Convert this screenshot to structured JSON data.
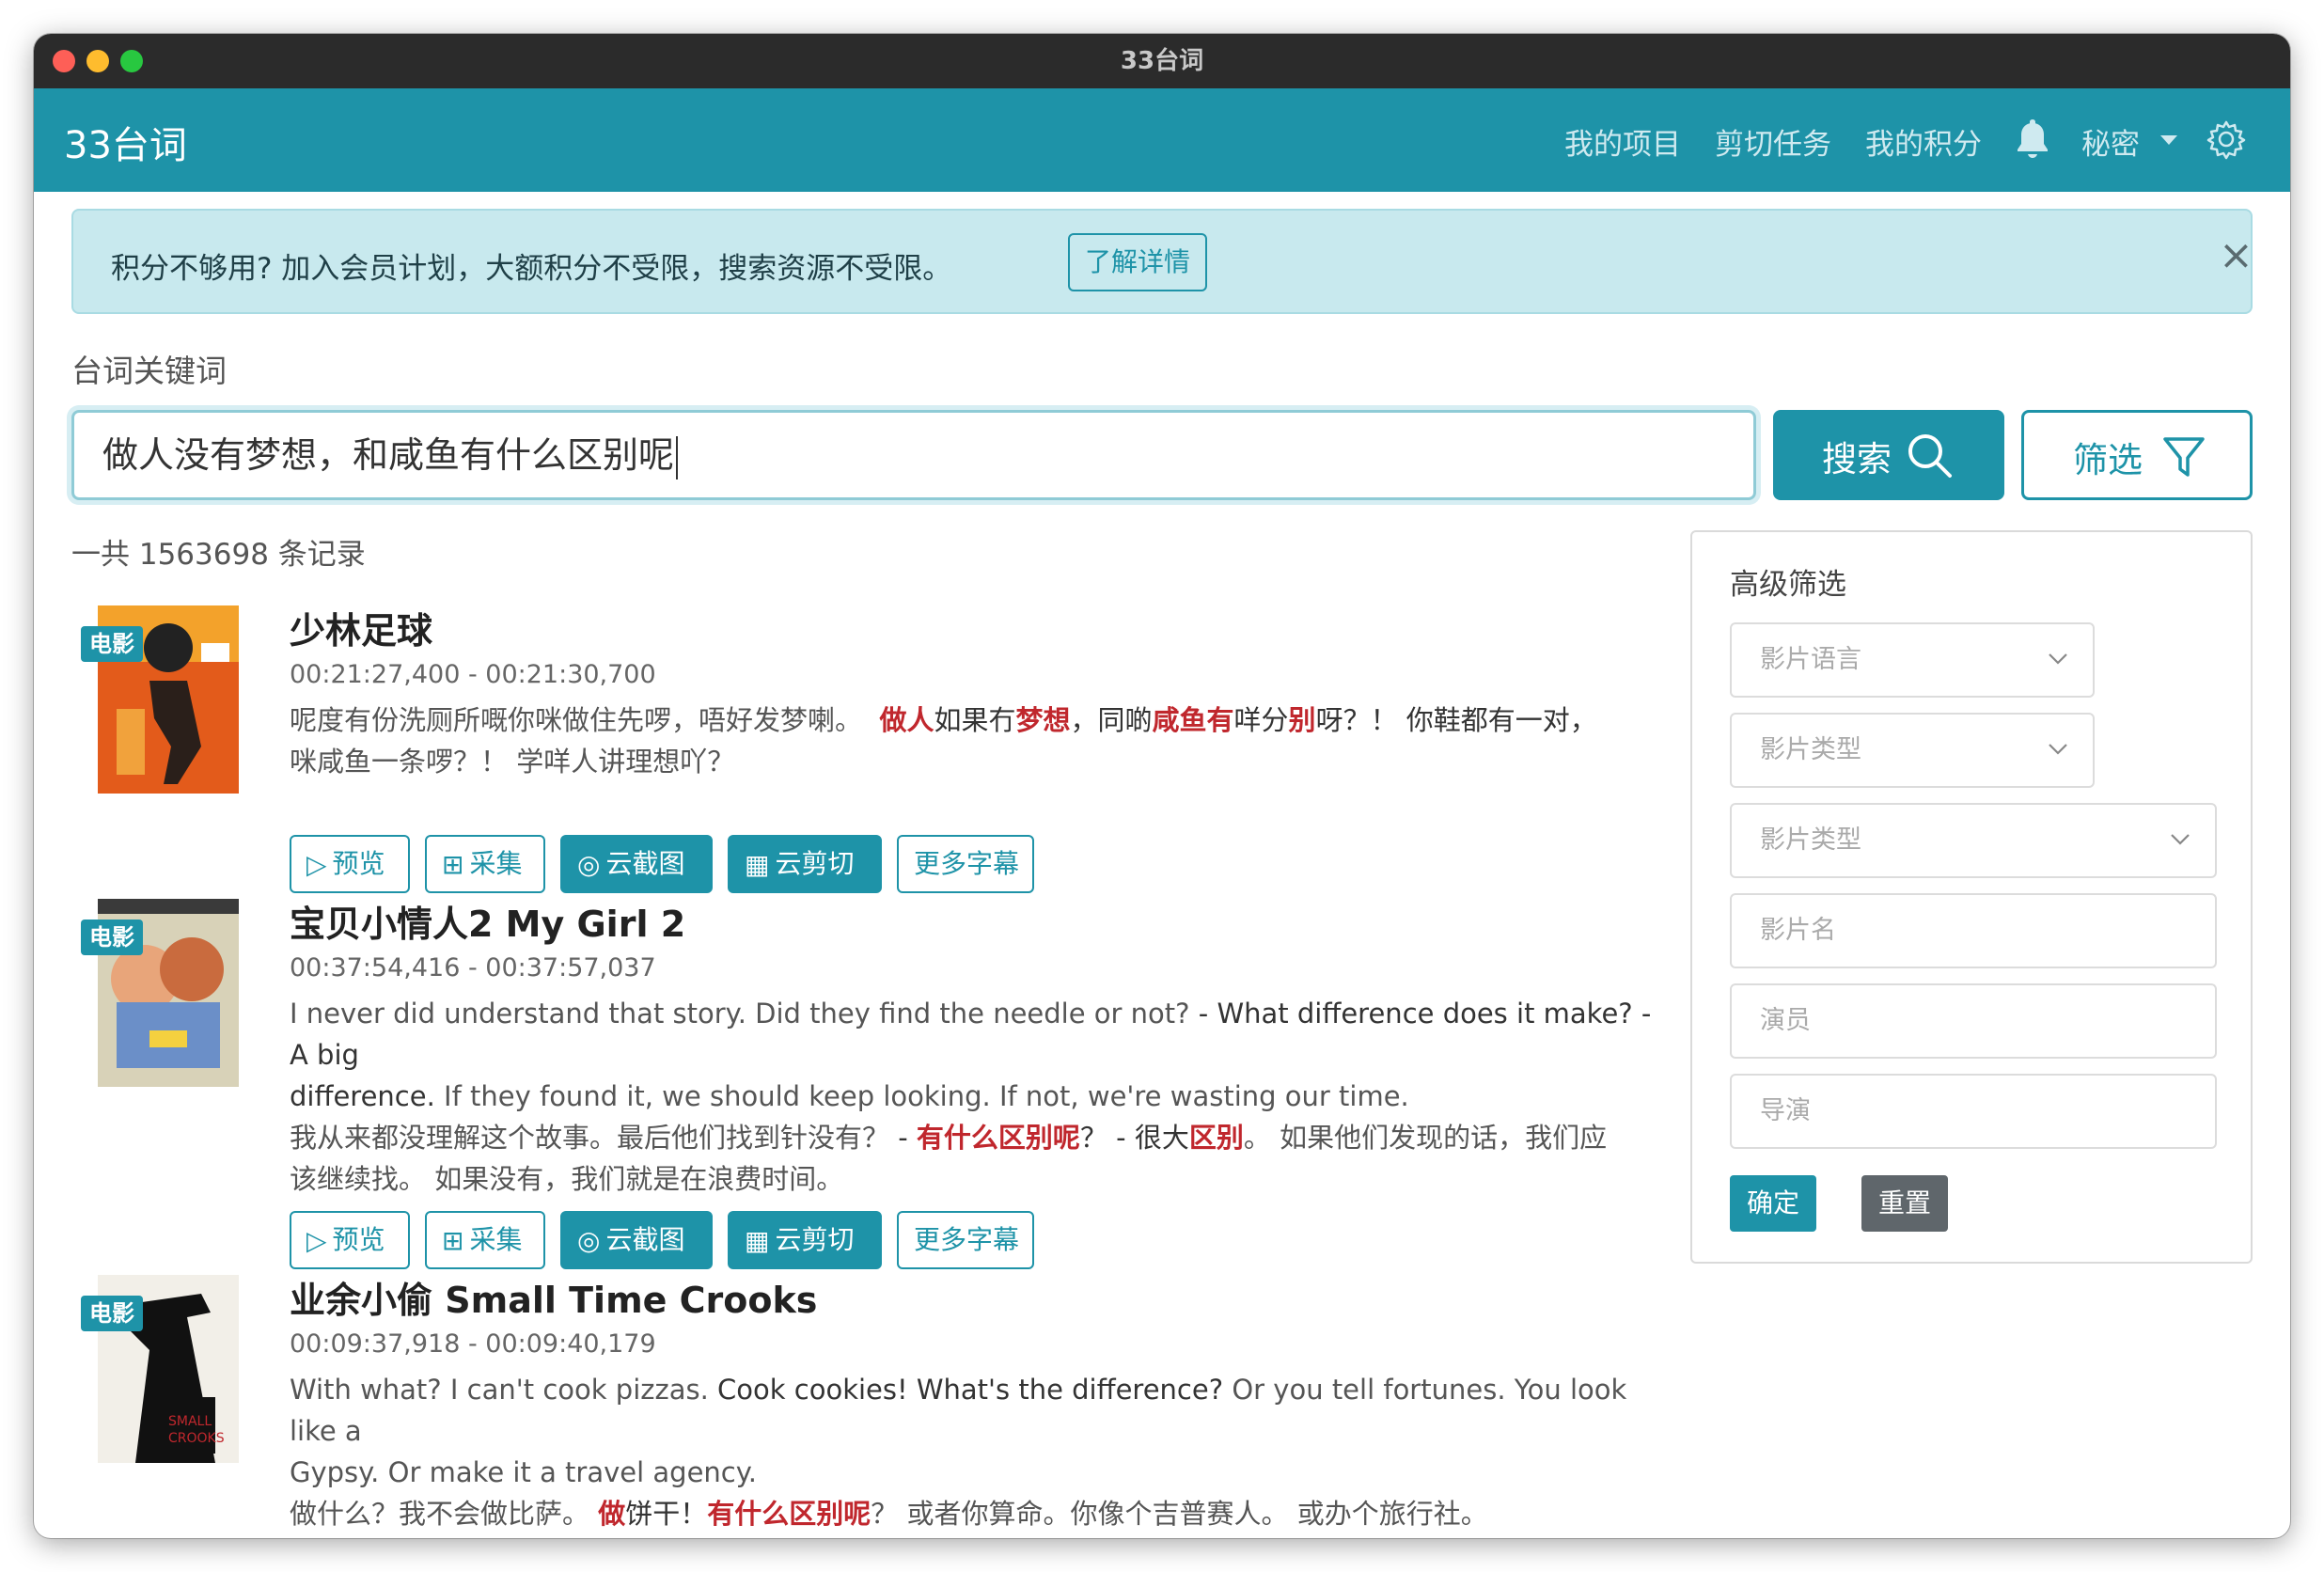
{
  "window": {
    "title": "33台词"
  },
  "navbar": {
    "brand": "33台词",
    "links": [
      "我的项目",
      "剪切任务",
      "我的积分"
    ],
    "user_menu": "秘密",
    "icons": [
      "bell-icon",
      "gear-icon",
      "chevron-down-icon"
    ]
  },
  "alert": {
    "text": "积分不够用? 加入会员计划，大额积分不受限，搜索资源不受限。",
    "button": "了解详情",
    "close": "×"
  },
  "search": {
    "label": "台词关键词",
    "value": "做人没有梦想，和咸鱼有什么区别呢",
    "button": "搜索",
    "filter_button": "筛选"
  },
  "results_count": "一共 1563698 条记录",
  "actions": {
    "preview": "预览",
    "collect": "采集",
    "screenshot": "云截图",
    "clip": "云剪切",
    "more": "更多字幕"
  },
  "results": [
    {
      "tag": "电影",
      "title": "少林足球",
      "time": "00:21:27,400 - 00:21:30,700",
      "text_line1_a": "呢度有份洗厕所嘅你咪做住先啰，唔好发梦喇。",
      "text_line1_b": "做人",
      "text_line1_c": "如果冇",
      "text_line1_d": "梦想",
      "text_line1_e": "，同啲",
      "text_line1_f": "咸鱼有",
      "text_line1_g": "咩分",
      "text_line1_h": "别",
      "text_line1_i": "呀？！ 你鞋都有一对，",
      "text_line2": "咪咸鱼一条啰？！ 学咩人讲理想吖？"
    },
    {
      "tag": "电影",
      "title": "宝贝小情人2 My Girl 2",
      "time": "00:37:54,416 - 00:37:57,037",
      "en_a": "I never did understand that story. Did they find the needle or not?",
      "en_b": " - What difference does it make? - A big",
      "en_c": "difference.",
      "en_d": " If they found it, we should keep looking. If not, we're wasting our time.",
      "zh_a": "我从来都没理解这个故事。最后他们找到针没有？",
      "zh_b": " - ",
      "zh_c": "有什么区别呢",
      "zh_d": "？ - 很大",
      "zh_e": "区别",
      "zh_f": "。 如果他们发现的话，我们应",
      "zh_g": "该继续找。 如果没有，我们就是在浪费时间。"
    },
    {
      "tag": "电影",
      "title": "业余小偷 Small Time Crooks",
      "time": "00:09:37,918 - 00:09:40,179",
      "en_a": "With what? I can't cook pizzas.",
      "en_b": " Cook cookies! What's the difference?",
      "en_c": " Or you tell fortunes. You look like a",
      "en_d": "Gypsy. Or make it a travel agency.",
      "zh_a": "做什么？我不会做比萨。",
      "zh_b": "做",
      "zh_c": "饼干！",
      "zh_d": "有什么区别呢",
      "zh_e": "？ 或者你算命。你像个吉普赛人。 或办个旅行社。"
    }
  ],
  "sidebar": {
    "title": "高级筛选",
    "fields": [
      "影片语言",
      "影片类型",
      "影片类型",
      "影片名",
      "演员",
      "导演"
    ],
    "confirm": "确定",
    "reset": "重置"
  }
}
